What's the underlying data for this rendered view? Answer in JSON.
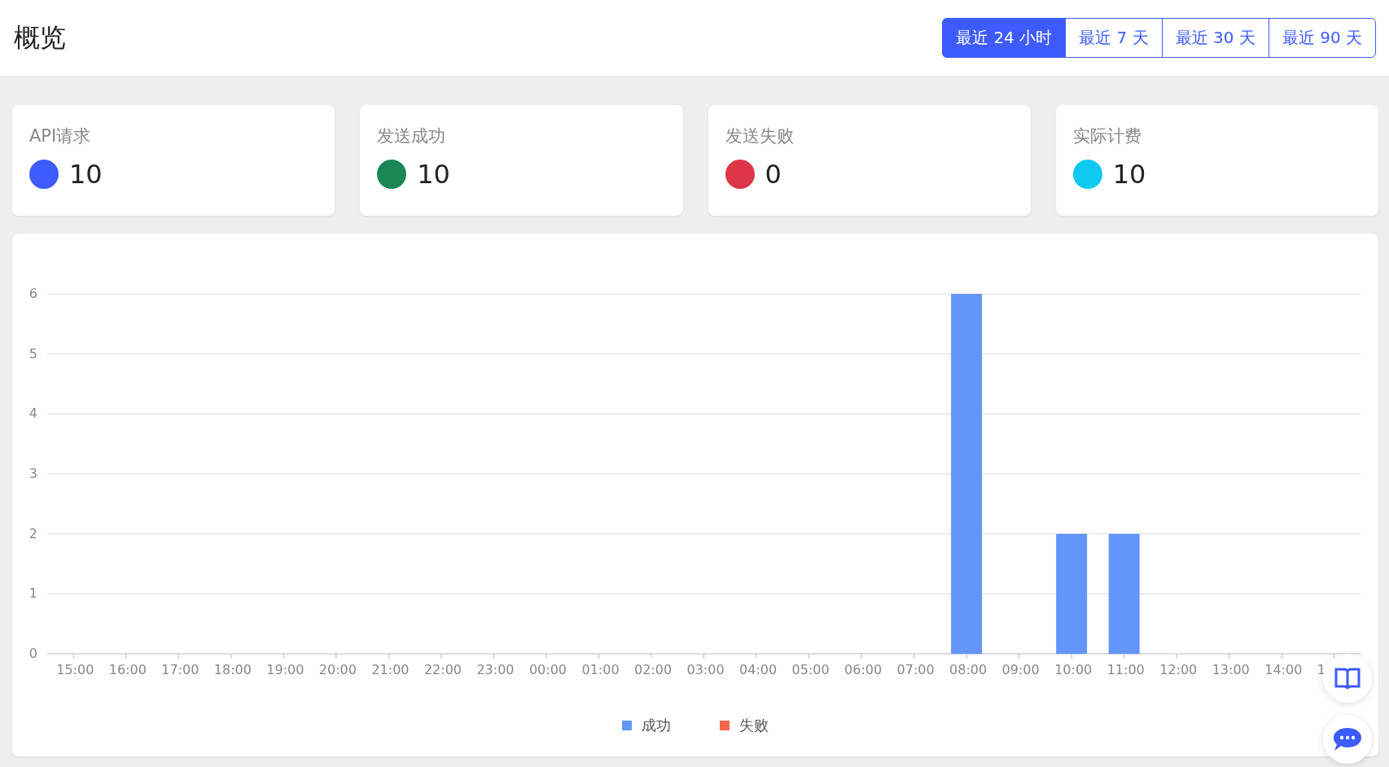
{
  "header": {
    "title": "概览",
    "ranges": [
      {
        "label": "最近 24 小时",
        "selected": true
      },
      {
        "label": "最近 7 天",
        "selected": false
      },
      {
        "label": "最近 30 天",
        "selected": false
      },
      {
        "label": "最近 90 天",
        "selected": false
      }
    ]
  },
  "stats": [
    {
      "label": "API请求",
      "value": "10",
      "color": "#3d5bfe"
    },
    {
      "label": "发送成功",
      "value": "10",
      "color": "#198754"
    },
    {
      "label": "发送失败",
      "value": "0",
      "color": "#dc3545"
    },
    {
      "label": "实际计费",
      "value": "10",
      "color": "#0dcaf0"
    }
  ],
  "chart": {
    "chart_data": {
      "type": "bar",
      "categories": [
        "15:00",
        "16:00",
        "17:00",
        "18:00",
        "19:00",
        "20:00",
        "21:00",
        "22:00",
        "23:00",
        "00:00",
        "01:00",
        "02:00",
        "03:00",
        "04:00",
        "05:00",
        "06:00",
        "07:00",
        "08:00",
        "09:00",
        "10:00",
        "11:00",
        "12:00",
        "13:00",
        "14:00",
        "1"
      ],
      "ylim": [
        0,
        6
      ],
      "yticks": [
        0,
        1,
        2,
        3,
        4,
        5,
        6
      ],
      "grid": true,
      "stacked": true,
      "series": [
        {
          "name": "成功",
          "color": "#6395fa",
          "values": [
            0,
            0,
            0,
            0,
            0,
            0,
            0,
            0,
            0,
            0,
            0,
            0,
            0,
            0,
            0,
            0,
            0,
            6,
            0,
            2,
            2,
            0,
            0,
            0,
            0
          ]
        },
        {
          "name": "失败",
          "color": "#f6664a",
          "values": [
            0,
            0,
            0,
            0,
            0,
            0,
            0,
            0,
            0,
            0,
            0,
            0,
            0,
            0,
            0,
            0,
            0,
            0,
            0,
            0,
            0,
            0,
            0,
            0,
            0
          ]
        }
      ]
    }
  },
  "floating_buttons": [
    {
      "kind": "docs"
    },
    {
      "kind": "chat"
    }
  ]
}
